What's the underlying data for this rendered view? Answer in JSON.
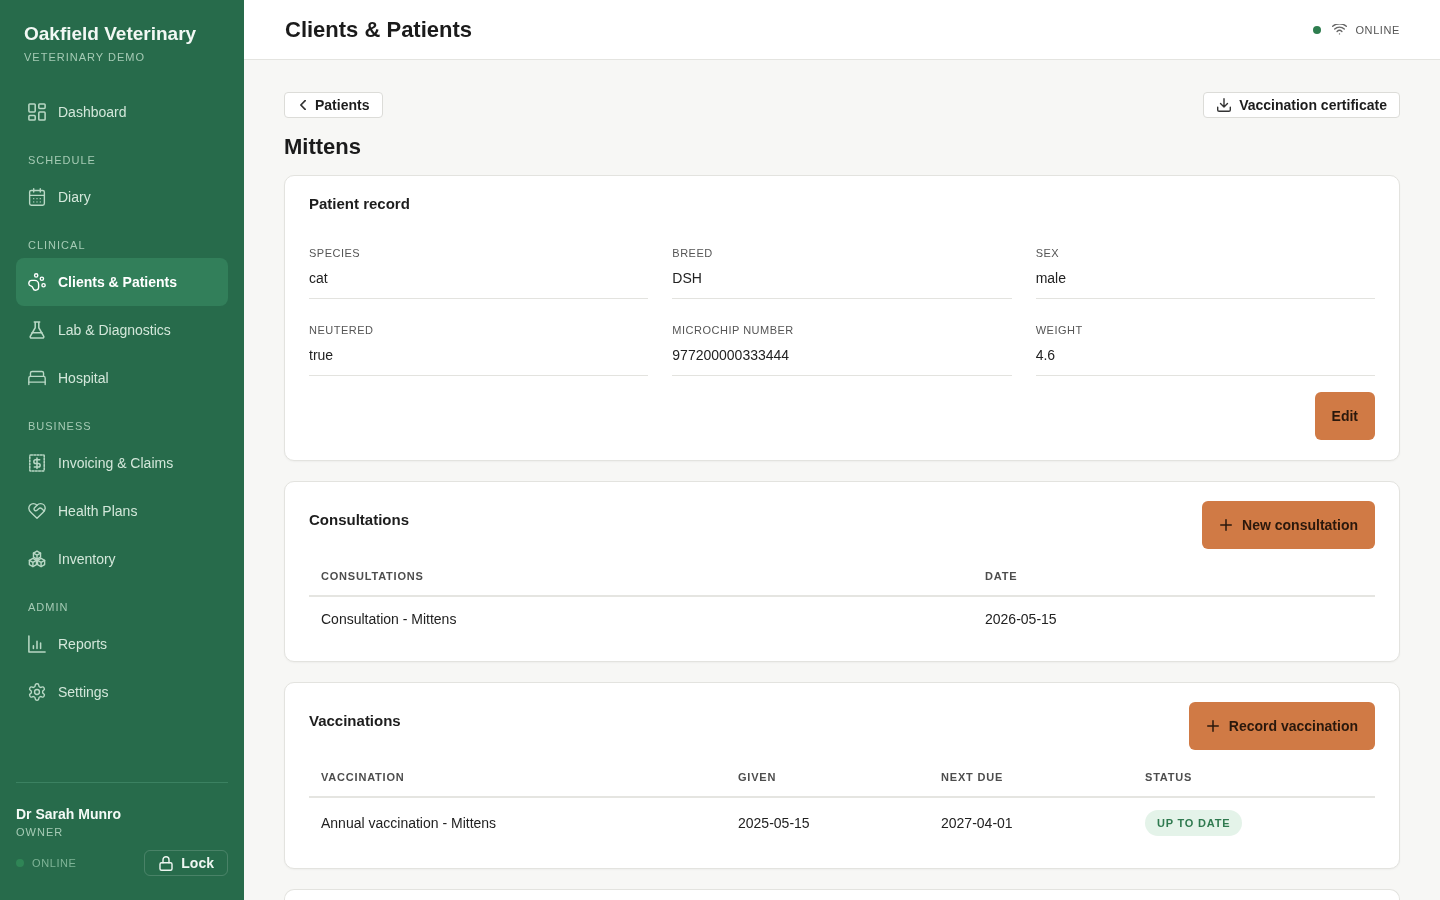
{
  "sidebar": {
    "brand": {
      "title": "Oakfield Veterinary",
      "subtitle": "VETERINARY DEMO"
    },
    "groups": [
      {
        "items": [
          {
            "label": "Dashboard",
            "selected": false
          }
        ]
      },
      {
        "heading": "SCHEDULE",
        "items": [
          {
            "label": "Diary",
            "selected": false
          }
        ]
      },
      {
        "heading": "CLINICAL",
        "items": [
          {
            "label": "Clients & Patients",
            "selected": true
          },
          {
            "label": "Lab & Diagnostics",
            "selected": false
          },
          {
            "label": "Hospital",
            "selected": false
          }
        ]
      },
      {
        "heading": "BUSINESS",
        "items": [
          {
            "label": "Invoicing & Claims",
            "selected": false
          },
          {
            "label": "Health Plans",
            "selected": false
          },
          {
            "label": "Inventory",
            "selected": false
          }
        ]
      },
      {
        "heading": "ADMIN",
        "items": [
          {
            "label": "Reports",
            "selected": false
          },
          {
            "label": "Settings",
            "selected": false
          }
        ]
      }
    ],
    "user": {
      "name": "Dr Sarah Munro",
      "role": "OWNER"
    },
    "connection": {
      "label": "ONLINE"
    },
    "lock_button": "Lock"
  },
  "header": {
    "title": "Clients & Patients",
    "connection": {
      "label": "ONLINE"
    }
  },
  "toolbar": {
    "back_button": "Patients",
    "certificate_button": "Vaccination certificate"
  },
  "patient": {
    "name": "Mittens"
  },
  "patient_record": {
    "title": "Patient record",
    "fields": [
      {
        "label": "SPECIES",
        "value": "cat"
      },
      {
        "label": "BREED",
        "value": "DSH"
      },
      {
        "label": "SEX",
        "value": "male"
      },
      {
        "label": "NEUTERED",
        "value": "true"
      },
      {
        "label": "MICROCHIP NUMBER",
        "value": "977200000333444"
      },
      {
        "label": "WEIGHT",
        "value": "4.6"
      }
    ],
    "edit_button": "Edit"
  },
  "record_sections": [
    {
      "title": "Consultations",
      "button": "New consultation",
      "table": {
        "columns": [
          "CONSULTATIONS",
          "DATE"
        ],
        "rows": [
          {
            "cells": [
              {
                "kind": "text",
                "text": "Consultation - Mittens"
              },
              {
                "kind": "text",
                "text": "2026-05-15"
              }
            ]
          }
        ]
      }
    },
    {
      "title": "Vaccinations",
      "button": "Record vaccination",
      "table": {
        "columns": [
          "VACCINATION",
          "GIVEN",
          "NEXT DUE",
          "STATUS"
        ],
        "rows": [
          {
            "cells": [
              {
                "kind": "text",
                "text": "Annual vaccination - Mittens"
              },
              {
                "kind": "text",
                "text": "2025-05-15"
              },
              {
                "kind": "text",
                "text": "2027-04-01"
              },
              {
                "kind": "badge",
                "text": "UP TO DATE"
              }
            ]
          }
        ]
      }
    }
  ]
}
